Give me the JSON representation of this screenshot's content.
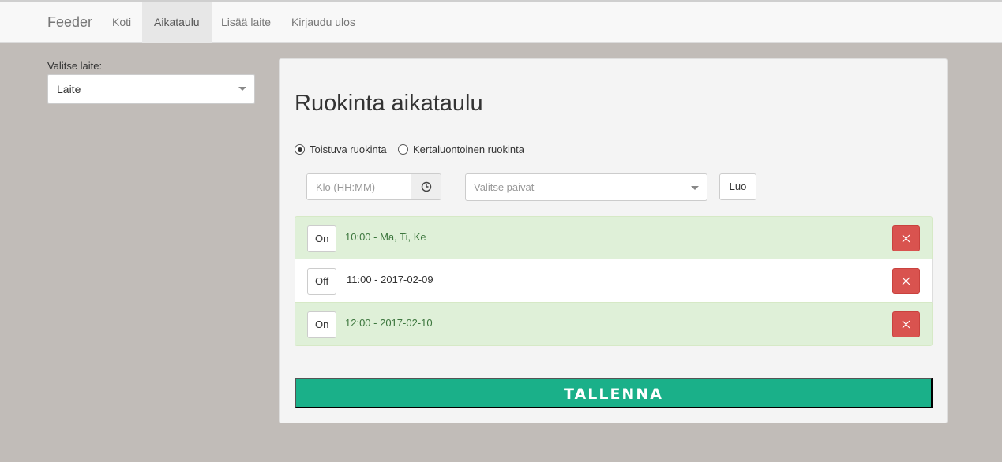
{
  "navbar": {
    "brand": "Feeder",
    "items": [
      {
        "label": "Koti",
        "active": false
      },
      {
        "label": "Aikataulu",
        "active": true
      },
      {
        "label": "Lisää laite",
        "active": false
      },
      {
        "label": "Kirjaudu ulos",
        "active": false
      }
    ]
  },
  "device": {
    "label": "Valitse laite:",
    "selected": "Laite"
  },
  "schedule_panel": {
    "title": "Ruokinta aikataulu",
    "radios": [
      {
        "label": "Toistuva ruokinta",
        "checked": true
      },
      {
        "label": "Kertaluontoinen ruokinta",
        "checked": false
      }
    ],
    "time_placeholder": "Klo (HH:MM)",
    "days_placeholder": "Valitse päivät",
    "create_label": "Luo",
    "entries": [
      {
        "toggle": "On",
        "text": "10:00 - Ma, Ti, Ke",
        "state": "on"
      },
      {
        "toggle": "Off",
        "text": "11:00 - 2017-02-09",
        "state": "off"
      },
      {
        "toggle": "On",
        "text": "12:00 - 2017-02-10",
        "state": "on"
      }
    ],
    "save_label": "TALLENNA"
  },
  "icons": {
    "time_addon": "clock-icon",
    "delete": "close-icon",
    "dropdown": "caret-down-icon"
  },
  "colors": {
    "background": "#c1bcb8",
    "on_row": "#dff0d8",
    "on_text": "#3c763d",
    "delete": "#d9534f",
    "save": "#1ab089"
  }
}
